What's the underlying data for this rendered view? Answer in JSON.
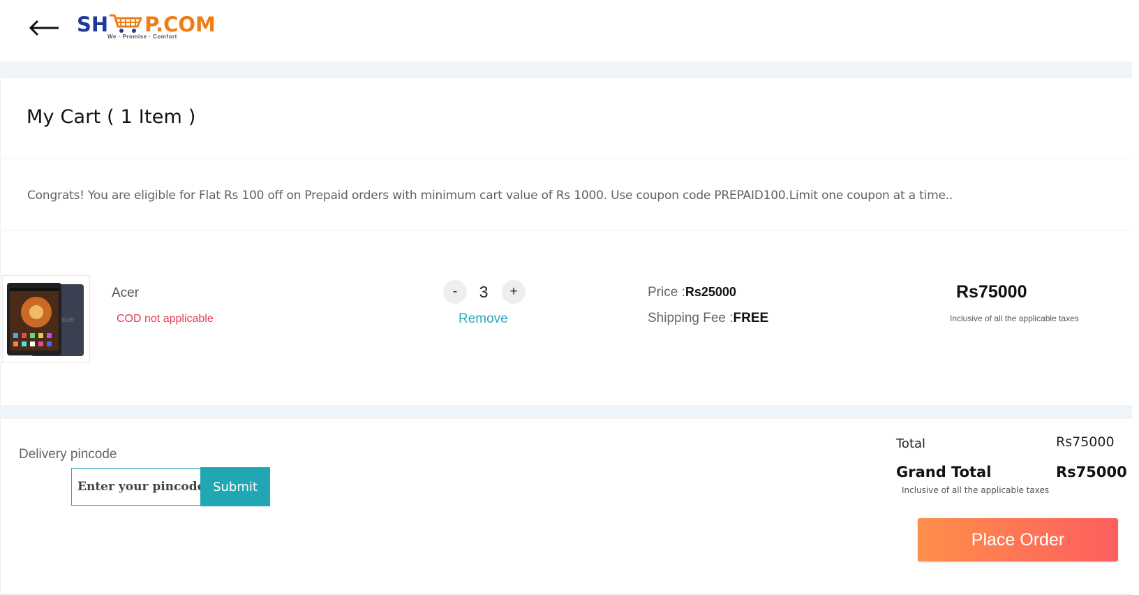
{
  "header": {
    "logo": {
      "left_text": "SH",
      "right_text": "P.COM",
      "tagline": "We · Promise · Comfort"
    },
    "icons": {
      "back": "arrow-left-icon",
      "cart": "shopping-cart-icon"
    }
  },
  "cart": {
    "title": "My Cart ( 1 Item )"
  },
  "offer": {
    "text": "Congrats! You are eligible for Flat Rs 100 off on Prepaid orders with minimum cart value of Rs 1000. Use coupon code PREPAID100.Limit one coupon at a time.."
  },
  "item": {
    "brand": "Acer",
    "cod_note": "COD not applicable",
    "quantity": {
      "minus": "-",
      "value": "3",
      "plus": "+"
    },
    "remove": "Remove",
    "price_label": "Price :",
    "price_value": "Rs25000",
    "shipping_label": "Shipping Fee :",
    "shipping_value": "FREE",
    "line_total": "Rs75000",
    "tax_note": "Inclusive of all the applicable taxes"
  },
  "delivery": {
    "label": "Delivery pincode",
    "placeholder": "Enter your pincode",
    "submit": "Submit"
  },
  "summary": {
    "total_label": "Total",
    "total_value": "Rs75000",
    "grand_label": "Grand Total",
    "grand_value": "Rs75000",
    "tax_note": "Inclusive of all the applicable taxes",
    "place_order": "Place Order"
  },
  "colors": {
    "brand_blue": "#1e3a9a",
    "brand_orange": "#f07c14",
    "accent_teal": "#21a6b3",
    "remove_link": "#2aa6c0",
    "cod_red": "#e53950",
    "order_gradient_start": "#fe8f4b",
    "order_gradient_end": "#fd5e5e",
    "band": "#eef4f8"
  }
}
